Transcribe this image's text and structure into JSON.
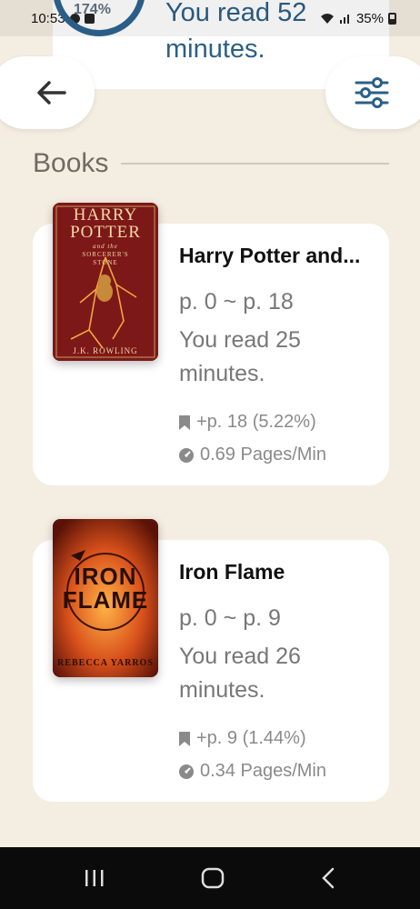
{
  "status_bar": {
    "time": "10:53",
    "battery": "35%"
  },
  "summary": {
    "progress_pct": "174%",
    "text": "You read 52 minutes."
  },
  "section": {
    "title": "Books"
  },
  "books": [
    {
      "title": "Harry Potter and...",
      "cover": {
        "line1": "HARRY",
        "line2": "POTTER",
        "subtitle_top": "and the",
        "subtitle": "SORCERER'S STONE",
        "author": "J.K. ROWLING",
        "bg_color": "#8a1d1d"
      },
      "range": "p. 0 ~ p. 18",
      "minutes": "You read 25 minutes.",
      "pages_added": "+p. 18 (5.22%)",
      "speed": "0.69 Pages/Min"
    },
    {
      "title": "Iron Flame",
      "cover": {
        "line1": "IRON",
        "line2": "FLAME",
        "author": "REBECCA YARROS",
        "bg_color": "#c2441a"
      },
      "range": "p. 0 ~ p. 9",
      "minutes": "You read 26 minutes.",
      "pages_added": "+p. 9 (1.44%)",
      "speed": "0.34 Pages/Min"
    }
  ],
  "icons": {
    "back": "back-arrow-icon",
    "filter": "sliders-icon",
    "bookmark": "bookmark-icon",
    "speed": "speedometer-icon"
  },
  "colors": {
    "background": "#f4ede1",
    "accent": "#2c5f86",
    "muted_text": "#777777"
  }
}
